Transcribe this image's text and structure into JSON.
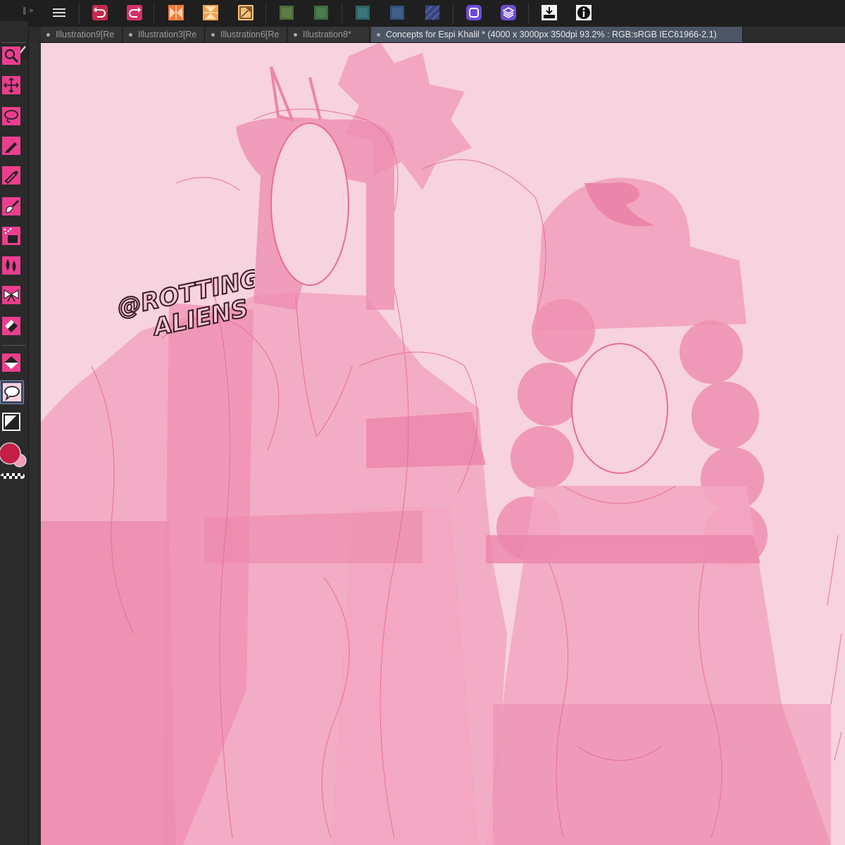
{
  "app": {
    "accent": "#e43b8a",
    "canvas_bg": "#f7d2df"
  },
  "command_bar": {
    "buttons": [
      {
        "name": "menu-icon"
      },
      {
        "name": "undo-icon"
      },
      {
        "name": "redo-icon"
      },
      {
        "name": "flip-horizontal-icon"
      },
      {
        "name": "flip-vertical-icon"
      },
      {
        "name": "fit-canvas-icon"
      },
      {
        "name": "layer-color-icon"
      },
      {
        "name": "layer-color-icon"
      },
      {
        "name": "layer-color-icon"
      },
      {
        "name": "layer-color-icon"
      },
      {
        "name": "layer-color-icon"
      },
      {
        "name": "layer-property-icon"
      },
      {
        "name": "layers-icon"
      },
      {
        "name": "export-icon"
      },
      {
        "name": "info-icon"
      }
    ]
  },
  "tabs": [
    {
      "label": "Illustration9[Re",
      "active": false
    },
    {
      "label": "Illustration3[Re",
      "active": false
    },
    {
      "label": "Illustration6[Re",
      "active": false
    },
    {
      "label": "Illustration8*",
      "active": false
    },
    {
      "label": "Concepts for Espi Khalil * (4000 x 3000px 350dpi 93.2% : RGB:sRGB IEC61966-2.1)",
      "active": true
    }
  ],
  "tools": [
    {
      "name": "zoom-tool-icon"
    },
    {
      "name": "move-tool-icon"
    },
    {
      "name": "lasso-tool-icon"
    },
    {
      "name": "pen-tool-icon"
    },
    {
      "name": "pencil-tool-icon"
    },
    {
      "name": "brush-tool-icon"
    },
    {
      "name": "airbrush-tool-icon"
    },
    {
      "name": "blend-tool-icon"
    },
    {
      "name": "decoration-tool-icon"
    },
    {
      "name": "eraser-tool-icon"
    },
    {
      "name": "fill-tool-icon"
    },
    {
      "name": "balloon-tool-icon"
    },
    {
      "name": "frame-tool-icon"
    }
  ],
  "colors": {
    "main": "#c41e45",
    "sub": "#f39ab8"
  },
  "watermark": {
    "line1": "@ROTTING",
    "line2": "ALIENS"
  }
}
